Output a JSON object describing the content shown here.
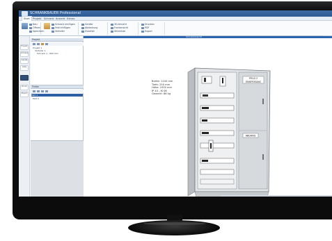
{
  "window": {
    "title": "SCHRANKBAUER Professional",
    "logo_icon": "app-logo-icon"
  },
  "ribbon_tabs": [
    "Start",
    "Projekt",
    "Schrank",
    "Ansicht",
    "Extras"
  ],
  "ribbon": {
    "groups": [
      {
        "name": "Projekt",
        "items": [
          "Neu",
          "Öffnen",
          "Speichern"
        ]
      },
      {
        "name": "Schrank",
        "items": [
          "Schrank einfügen",
          "Feld einfügen",
          "Verteiler"
        ]
      },
      {
        "name": "Bauteile",
        "items": [
          "Geräte",
          "Abdeckung",
          "Zubehör"
        ]
      },
      {
        "name": "Ansicht",
        "items": [
          "3D-Ansicht",
          "Frontansicht",
          "Stückliste"
        ]
      },
      {
        "name": "Export",
        "items": [
          "Drucken",
          "PDF",
          "Export"
        ]
      }
    ],
    "edge_button": "Hilfe",
    "active_tab_index": 0
  },
  "blue_bar_label": "Schrankansicht",
  "left_strip": {
    "buttons": [
      "Projekt",
      "Schrank",
      "Geräte",
      "Liste",
      "",
      "Druck",
      "Export"
    ],
    "selected_index": 4
  },
  "project_panel": {
    "header": "Projekt",
    "tree": [
      "Projekt 1",
      "Verteiler 1",
      "Schrank 1 - 800 mm"
    ],
    "second_header": "Felder",
    "second_rows": [
      "Feld 1",
      "Feld 2"
    ],
    "selected_row": "Feld 1"
  },
  "cabinet_info": {
    "lines": [
      "Breite: 1100 mm",
      "Tiefe: 250 mm",
      "Höhe: 1950 mm",
      "IP 43 - IK 08",
      "Gewicht: 86 kg"
    ]
  },
  "cabinet_labels": {
    "top_right": [
      "FELD 2",
      "EINSPEISUNG"
    ],
    "mid_right": "ABGANG"
  },
  "colors": {
    "accent": "#2b64ad",
    "bezel": "#0c0c0d",
    "cabinet_gray": "#d9dbde"
  }
}
